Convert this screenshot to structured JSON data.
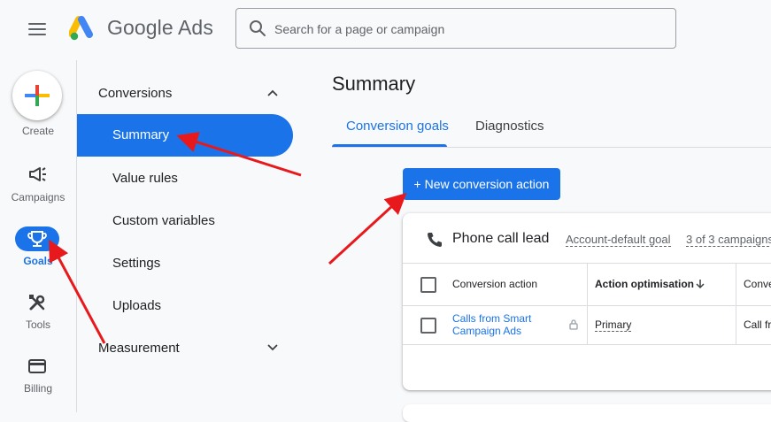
{
  "header": {
    "menu_icon": "hamburger-menu-icon",
    "logo_text": "Google Ads",
    "search_placeholder": "Search for a page or campaign"
  },
  "rail": {
    "items": [
      {
        "label": "Create",
        "icon": "plus-icon"
      },
      {
        "label": "Campaigns",
        "icon": "megaphone-icon"
      },
      {
        "label": "Goals",
        "icon": "trophy-icon",
        "active": true
      },
      {
        "label": "Tools",
        "icon": "tools-icon"
      },
      {
        "label": "Billing",
        "icon": "credit-card-icon"
      }
    ]
  },
  "submenu": {
    "section1": "Conversions",
    "items": [
      "Summary",
      "Value rules",
      "Custom variables",
      "Settings",
      "Uploads"
    ],
    "active_item": "Summary",
    "section2": "Measurement"
  },
  "main": {
    "title": "Summary",
    "tabs": [
      {
        "label": "Conversion goals",
        "active": true
      },
      {
        "label": "Diagnostics",
        "active": false
      }
    ],
    "new_button": "+ New conversion action",
    "card": {
      "title": "Phone call lead",
      "goal_type": "Account-default goal",
      "campaigns": "3 of 3 campaigns",
      "columns": [
        "Conversion action",
        "Action optimisation",
        "Conve"
      ],
      "rows": [
        {
          "action_line1": "Calls from Smart",
          "action_line2": "Campaign Ads",
          "optimisation": "Primary",
          "source": "Call fr"
        }
      ]
    }
  },
  "colors": {
    "accent": "#1a73e8",
    "annotation_arrow": "#e8191c"
  }
}
